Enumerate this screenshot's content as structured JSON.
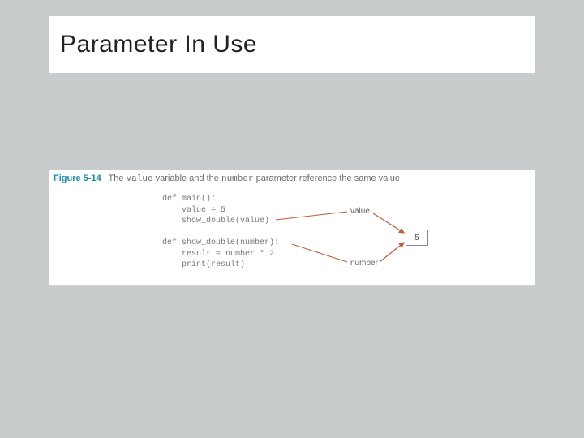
{
  "title": "Parameter In Use",
  "figure": {
    "label": "Figure 5-14",
    "caption_pre": "The ",
    "caption_var1": "value",
    "caption_mid": " variable and the ",
    "caption_var2": "number",
    "caption_post": " parameter reference the same value",
    "code_block1": "def main():\n    value = 5\n    show_double(value)",
    "code_block2": "def show_double(number):\n    result = number * 2\n    print(result)",
    "annot_value": "value",
    "annot_number": "number",
    "box_value": "5"
  }
}
